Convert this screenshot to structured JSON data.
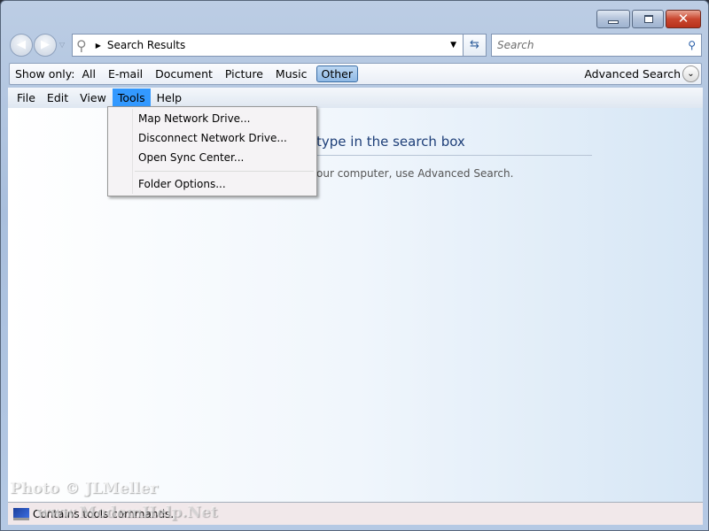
{
  "window": {
    "controls": {
      "minimize": "minimize-icon",
      "maximize": "maximize-icon",
      "close": "close-icon"
    }
  },
  "address": {
    "location": "Search Results"
  },
  "search": {
    "placeholder": "Search"
  },
  "show_only": {
    "label": "Show only:",
    "filters": [
      "All",
      "E-mail",
      "Document",
      "Picture",
      "Music",
      "Other"
    ],
    "selected": "Other",
    "advanced": "Advanced Search"
  },
  "menubar": {
    "items": [
      "File",
      "Edit",
      "View",
      "Tools",
      "Help"
    ],
    "active": "Tools"
  },
  "tools_menu": {
    "items": [
      "Map Network Drive...",
      "Disconnect Network Drive...",
      "Open Sync Center...",
      "Folder Options..."
    ]
  },
  "content": {
    "heading": "type in the search box",
    "subtext": "our computer, use Advanced Search."
  },
  "status": {
    "text": "Contains tools commands."
  },
  "watermark": {
    "line1": "Photo © JLMeller",
    "line2": "www.ModemHelp.Net"
  },
  "colors": {
    "menu_highlight": "#3399ff",
    "heading": "#1e3f78",
    "close_button": "#c9462f"
  }
}
